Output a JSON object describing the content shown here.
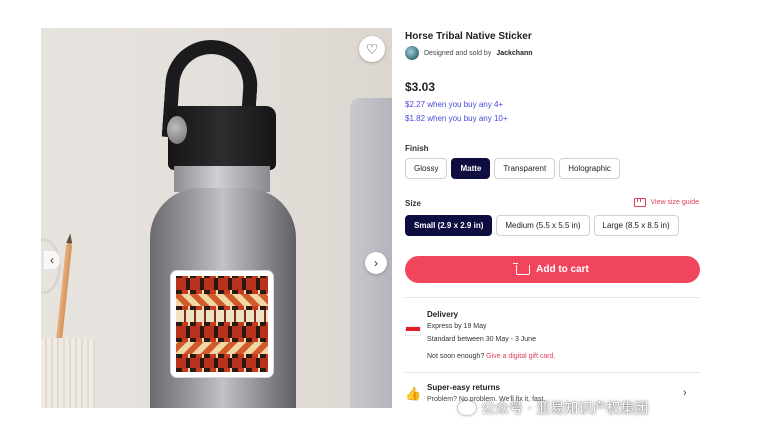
{
  "product": {
    "title": "Horse Tribal Native Sticker",
    "seller_prefix": "Designed and sold by",
    "seller_name": "Jackchann",
    "price": "$3.03",
    "tiers": [
      "$2.27 when you buy any 4+",
      "$1.82 when you buy any 10+"
    ]
  },
  "finish": {
    "label": "Finish",
    "options": [
      "Glossy",
      "Matte",
      "Transparent",
      "Holographic"
    ],
    "selected": "Matte"
  },
  "size": {
    "label": "Size",
    "guide": "View size guide",
    "options": [
      "Small (2.9 x 2.9 in)",
      "Medium (5.5 x 5.5 in)",
      "Large (8.5 x 8.5 in)"
    ],
    "selected": "Small (2.9 x 2.9 in)"
  },
  "cart": {
    "label": "Add to cart"
  },
  "delivery": {
    "title": "Delivery",
    "express": "Express by 19 May",
    "standard": "Standard between 30 May - 3 June",
    "gift_prefix": "Not soon enough?",
    "gift_link": "Give a digital gift card."
  },
  "returns": {
    "title": "Super-easy returns",
    "sub": "Problem? No problem. We'll fix it, fast."
  },
  "gallery": {
    "fav_icon": "♡",
    "prev_icon": "‹",
    "next_icon": "›"
  },
  "watermark": "公众号 · 亚易知识产权集团",
  "colors": {
    "accent": "#f1455d",
    "selected": "#0d0d3f",
    "link": "#4a4adb"
  }
}
